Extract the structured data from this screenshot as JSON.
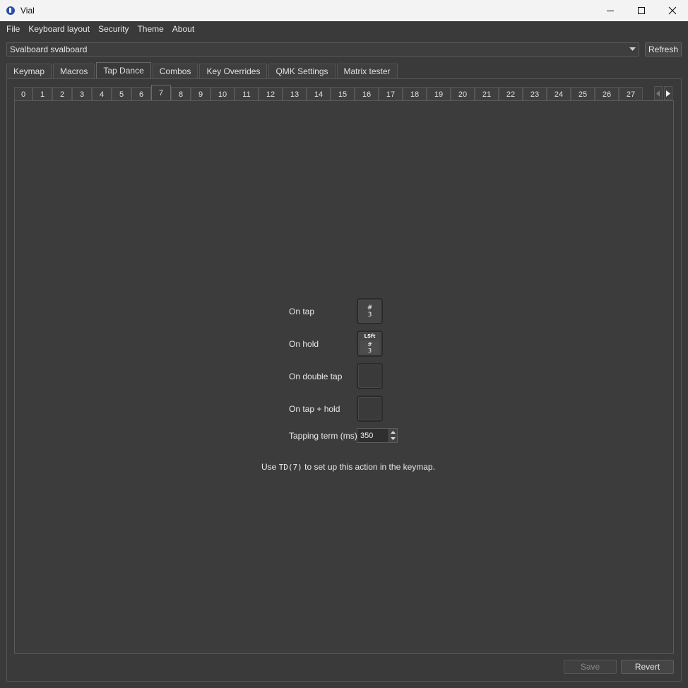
{
  "window": {
    "title": "Vial",
    "icon": "vial-app-icon",
    "controls": [
      "minimize-icon",
      "maximize-icon",
      "close-icon"
    ]
  },
  "menu": [
    "File",
    "Keyboard layout",
    "Security",
    "Theme",
    "About"
  ],
  "keyboard_selector": {
    "value": "Svalboard svalboard",
    "refresh_label": "Refresh"
  },
  "main_tabs": [
    "Keymap",
    "Macros",
    "Tap Dance",
    "Combos",
    "Key Overrides",
    "QMK Settings",
    "Matrix tester"
  ],
  "main_tab_active": "Tap Dance",
  "tapdance_tabs": [
    "0",
    "1",
    "2",
    "3",
    "4",
    "5",
    "6",
    "7",
    "8",
    "9",
    "10",
    "11",
    "12",
    "13",
    "14",
    "15",
    "16",
    "17",
    "18",
    "19",
    "20",
    "21",
    "22",
    "23",
    "24",
    "25",
    "26",
    "27"
  ],
  "tapdance_tab_active": "7",
  "form": {
    "on_tap": {
      "label": "On tap",
      "key_top": "#",
      "key_bottom": "3"
    },
    "on_hold": {
      "label": "On hold",
      "mod": "LSft",
      "key_top": "#",
      "key_bottom": "3"
    },
    "on_double_tap": {
      "label": "On double tap"
    },
    "on_tap_hold": {
      "label": "On tap + hold"
    },
    "tapping_term": {
      "label": "Tapping term (ms)",
      "value": "350"
    }
  },
  "hint": {
    "prefix": "Use",
    "code": "TD(7)",
    "suffix": "to set up this action in the keymap."
  },
  "footer": {
    "save_label": "Save",
    "revert_label": "Revert"
  },
  "colors": {
    "background": "#3a3a3a",
    "titlebar": "#f3f3f3",
    "text": "#e8e8e8",
    "disabled_text": "#888888"
  }
}
